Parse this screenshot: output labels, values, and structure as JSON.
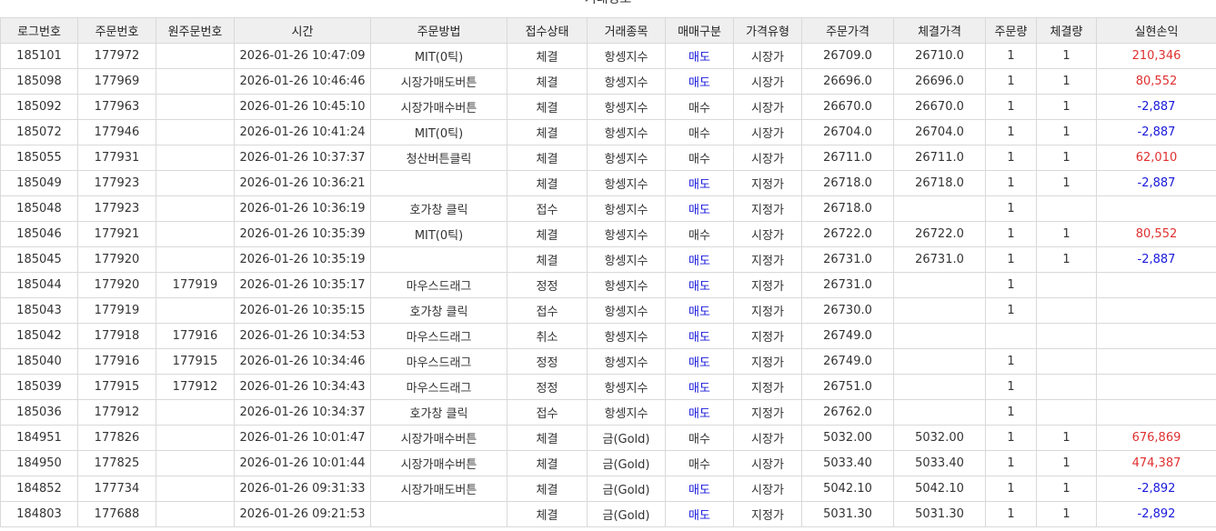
{
  "panel": {
    "title": "거래정보"
  },
  "columns": [
    "로그번호",
    "주문번호",
    "원주문번호",
    "시간",
    "주문방법",
    "접수상태",
    "거래종목",
    "매매구분",
    "가격유형",
    "주문가격",
    "체결가격",
    "주문량",
    "체결량",
    "실현손익"
  ],
  "rows": [
    [
      "185101",
      "177972",
      "",
      "2026-01-26 10:47:09",
      "MIT(0틱)",
      "체결",
      "항셍지수",
      "매도",
      "시장가",
      "26709.0",
      "26710.0",
      "1",
      "1",
      "210,346"
    ],
    [
      "185098",
      "177969",
      "",
      "2026-01-26 10:46:46",
      "시장가매도버튼",
      "체결",
      "항셍지수",
      "매도",
      "시장가",
      "26696.0",
      "26696.0",
      "1",
      "1",
      "80,552"
    ],
    [
      "185092",
      "177963",
      "",
      "2026-01-26 10:45:10",
      "시장가매수버튼",
      "체결",
      "항셍지수",
      "매수",
      "시장가",
      "26670.0",
      "26670.0",
      "1",
      "1",
      "-2,887"
    ],
    [
      "185072",
      "177946",
      "",
      "2026-01-26 10:41:24",
      "MIT(0틱)",
      "체결",
      "항셍지수",
      "매수",
      "시장가",
      "26704.0",
      "26704.0",
      "1",
      "1",
      "-2,887"
    ],
    [
      "185055",
      "177931",
      "",
      "2026-01-26 10:37:37",
      "청산버튼클릭",
      "체결",
      "항셍지수",
      "매수",
      "시장가",
      "26711.0",
      "26711.0",
      "1",
      "1",
      "62,010"
    ],
    [
      "185049",
      "177923",
      "",
      "2026-01-26 10:36:21",
      "",
      "체결",
      "항셍지수",
      "매도",
      "지정가",
      "26718.0",
      "26718.0",
      "1",
      "1",
      "-2,887"
    ],
    [
      "185048",
      "177923",
      "",
      "2026-01-26 10:36:19",
      "호가창 클릭",
      "접수",
      "항셍지수",
      "매도",
      "지정가",
      "26718.0",
      "",
      "1",
      "",
      ""
    ],
    [
      "185046",
      "177921",
      "",
      "2026-01-26 10:35:39",
      "MIT(0틱)",
      "체결",
      "항셍지수",
      "매수",
      "시장가",
      "26722.0",
      "26722.0",
      "1",
      "1",
      "80,552"
    ],
    [
      "185045",
      "177920",
      "",
      "2026-01-26 10:35:19",
      "",
      "체결",
      "항셍지수",
      "매도",
      "지정가",
      "26731.0",
      "26731.0",
      "1",
      "1",
      "-2,887"
    ],
    [
      "185044",
      "177920",
      "177919",
      "2026-01-26 10:35:17",
      "마우스드래그",
      "정정",
      "항셍지수",
      "매도",
      "지정가",
      "26731.0",
      "",
      "1",
      "",
      ""
    ],
    [
      "185043",
      "177919",
      "",
      "2026-01-26 10:35:15",
      "호가창 클릭",
      "접수",
      "항셍지수",
      "매도",
      "지정가",
      "26730.0",
      "",
      "1",
      "",
      ""
    ],
    [
      "185042",
      "177918",
      "177916",
      "2026-01-26 10:34:53",
      "마우스드래그",
      "취소",
      "항셍지수",
      "매도",
      "지정가",
      "26749.0",
      "",
      "",
      "",
      ""
    ],
    [
      "185040",
      "177916",
      "177915",
      "2026-01-26 10:34:46",
      "마우스드래그",
      "정정",
      "항셍지수",
      "매도",
      "지정가",
      "26749.0",
      "",
      "1",
      "",
      ""
    ],
    [
      "185039",
      "177915",
      "177912",
      "2026-01-26 10:34:43",
      "마우스드래그",
      "정정",
      "항셍지수",
      "매도",
      "지정가",
      "26751.0",
      "",
      "1",
      "",
      ""
    ],
    [
      "185036",
      "177912",
      "",
      "2026-01-26 10:34:37",
      "호가창 클릭",
      "접수",
      "항셍지수",
      "매도",
      "지정가",
      "26762.0",
      "",
      "1",
      "",
      ""
    ],
    [
      "184951",
      "177826",
      "",
      "2026-01-26 10:01:47",
      "시장가매수버튼",
      "체결",
      "금(Gold)",
      "매수",
      "시장가",
      "5032.00",
      "5032.00",
      "1",
      "1",
      "676,869"
    ],
    [
      "184950",
      "177825",
      "",
      "2026-01-26 10:01:44",
      "시장가매수버튼",
      "체결",
      "금(Gold)",
      "매수",
      "시장가",
      "5033.40",
      "5033.40",
      "1",
      "1",
      "474,387"
    ],
    [
      "184852",
      "177734",
      "",
      "2026-01-26 09:31:33",
      "시장가매도버튼",
      "체결",
      "금(Gold)",
      "매도",
      "시장가",
      "5042.10",
      "5042.10",
      "1",
      "1",
      "-2,892"
    ],
    [
      "184803",
      "177688",
      "",
      "2026-01-26 09:21:53",
      "",
      "체결",
      "금(Gold)",
      "매도",
      "지정가",
      "5031.30",
      "5031.30",
      "1",
      "1",
      "-2,892"
    ]
  ],
  "colors": {
    "sell": "#1a1adb",
    "profit_positive": "#e03030",
    "profit_negative": "#1a1adb"
  }
}
